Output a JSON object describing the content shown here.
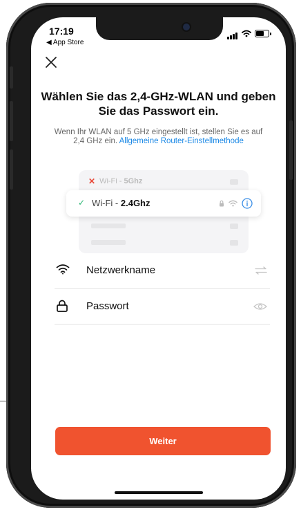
{
  "status_bar": {
    "time": "17:19",
    "back_label": "◀ App Store"
  },
  "header": {
    "title": "Wählen Sie das 2,4-GHz-WLAN und geben Sie das Passwort ein.",
    "subtitle_text": "Wenn Ihr WLAN auf 5 GHz eingestellt ist, stellen Sie es auf 2,4 GHz ein.",
    "subtitle_link": "Allgemeine Router-Einstellmethode"
  },
  "illustration": {
    "wifi_5g_prefix": "Wi-Fi - ",
    "wifi_5g_band": "5Ghz",
    "wifi_24g_prefix": "Wi-Fi - ",
    "wifi_24g_band": "2.4Ghz"
  },
  "form": {
    "network_label": "Netzwerkname",
    "password_label": "Passwort"
  },
  "actions": {
    "continue_label": "Weiter"
  },
  "colors": {
    "accent": "#f0532f",
    "link": "#1a88e6",
    "success": "#2bb673",
    "error": "#e84b3c"
  }
}
